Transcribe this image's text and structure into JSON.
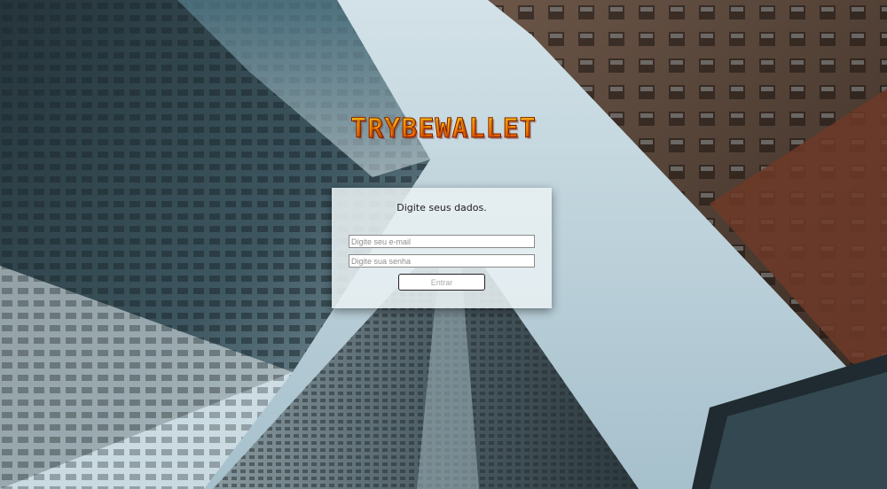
{
  "app": {
    "logo_text": "TRYBEWALLET"
  },
  "login": {
    "title": "Digite seus dados.",
    "email_placeholder": "Digite seu e-mail",
    "email_value": "",
    "password_placeholder": "Digite sua senha",
    "password_value": "",
    "submit_label": "Entrar"
  },
  "colors": {
    "logo_top": "#ffd21a",
    "logo_bottom": "#e03a00",
    "sky": "#c9dce3"
  }
}
